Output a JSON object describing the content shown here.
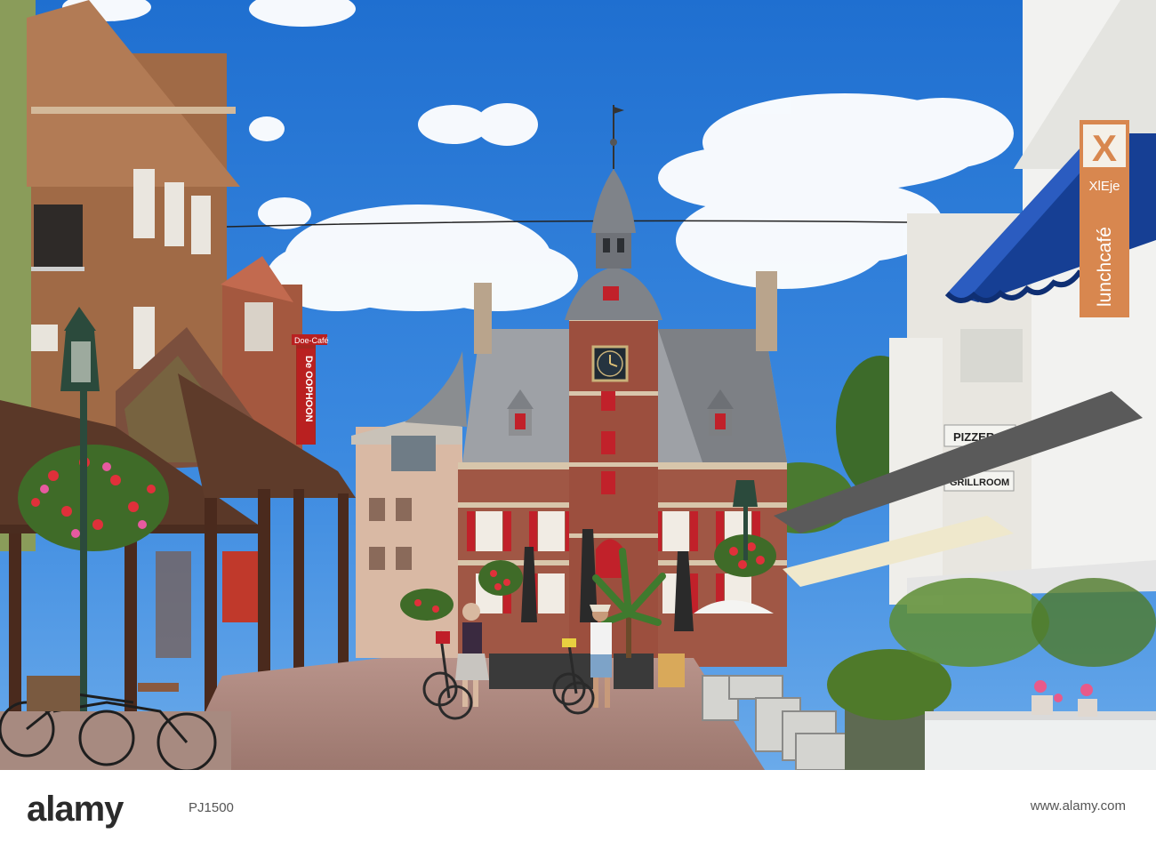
{
  "signs": {
    "lunchcafe": "lunchcafé",
    "xleje": "XlEje",
    "pizzeria": "PIZZER",
    "grillroom": "GRILLROOM",
    "doecafe": "Doe-Café",
    "dedoophoon": "De OOPHOON"
  },
  "footer": {
    "brand": "alamy",
    "stock_id": "PJ1500",
    "site": "www.alamy.com"
  }
}
